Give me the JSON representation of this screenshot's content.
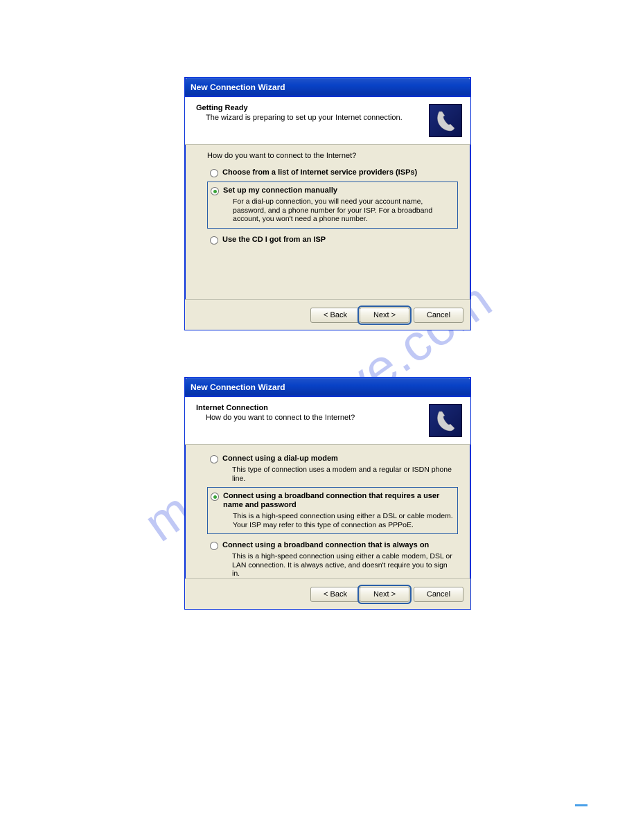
{
  "watermark": "manualshive.com",
  "dialogs": [
    {
      "title": "New Connection Wizard",
      "header_title": "Getting Ready",
      "header_sub": "The wizard is preparing to set up your Internet connection.",
      "prompt": "How do you want to connect to the Internet?",
      "options": [
        {
          "label": "Choose from a list of Internet service providers (ISPs)",
          "desc": "",
          "selected": false,
          "boxed": false
        },
        {
          "label": "Set up my connection manually",
          "desc": "For a dial-up connection, you will need your account name, password, and a phone number for your ISP. For a broadband account, you won't need a phone number.",
          "selected": true,
          "boxed": true
        },
        {
          "label": "Use the CD I got from an ISP",
          "desc": "",
          "selected": false,
          "boxed": false
        }
      ],
      "buttons": {
        "back": "< Back",
        "next": "Next >",
        "cancel": "Cancel"
      }
    },
    {
      "title": "New Connection Wizard",
      "header_title": "Internet Connection",
      "header_sub": "How do you want to connect to the Internet?",
      "prompt": "",
      "options": [
        {
          "label": "Connect using a dial-up modem",
          "desc": "This type of connection uses a modem and a regular or ISDN phone line.",
          "selected": false,
          "boxed": false
        },
        {
          "label": "Connect using a broadband connection that requires a user name and password",
          "desc": "This is a high-speed connection using either a DSL or cable modem. Your ISP may refer to this type of connection as PPPoE.",
          "selected": true,
          "boxed": true
        },
        {
          "label": "Connect using a broadband connection that is always on",
          "desc": "This is a high-speed connection using either a cable modem, DSL or LAN connection. It is always active, and doesn't require you to sign in.",
          "selected": false,
          "boxed": false
        }
      ],
      "buttons": {
        "back": "< Back",
        "next": "Next >",
        "cancel": "Cancel"
      }
    }
  ]
}
